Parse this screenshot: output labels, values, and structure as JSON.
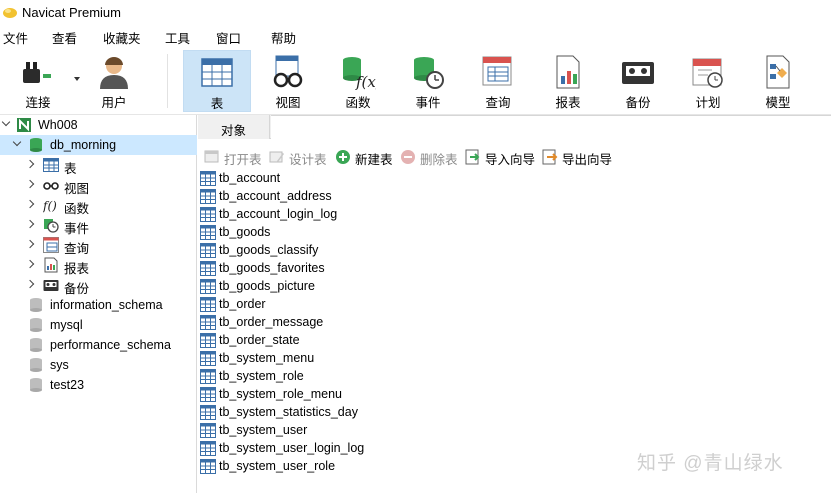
{
  "window": {
    "title": "Navicat Premium"
  },
  "menu": [
    "文件",
    "查看",
    "收藏夹",
    "工具",
    "窗口",
    "帮助"
  ],
  "toolbar": {
    "connect": "连接",
    "user": "用户",
    "table": "表",
    "view": "视图",
    "function": "函数",
    "event": "事件",
    "query": "查询",
    "report": "报表",
    "backup": "备份",
    "schedule": "计划",
    "model": "模型"
  },
  "tree": {
    "connection": "Wh008",
    "database": "db_morning",
    "children": [
      "表",
      "视图",
      "函数",
      "事件",
      "查询",
      "报表",
      "备份"
    ],
    "other_dbs": [
      "information_schema",
      "mysql",
      "performance_schema",
      "sys",
      "test23"
    ]
  },
  "tabs": {
    "objects": "对象"
  },
  "object_toolbar": {
    "open": "打开表",
    "design": "设计表",
    "new": "新建表",
    "delete": "删除表",
    "import": "导入向导",
    "export": "导出向导"
  },
  "tables": [
    "tb_account",
    "tb_account_address",
    "tb_account_login_log",
    "tb_goods",
    "tb_goods_classify",
    "tb_goods_favorites",
    "tb_goods_picture",
    "tb_order",
    "tb_order_message",
    "tb_order_state",
    "tb_system_menu",
    "tb_system_role",
    "tb_system_role_menu",
    "tb_system_statistics_day",
    "tb_system_user",
    "tb_system_user_login_log",
    "tb_system_user_role"
  ],
  "watermark": "知乎 @青山绿水",
  "colors": {
    "accent": "#cce4f7",
    "selected": "#cce8ff",
    "db_green": "#3aa655"
  }
}
